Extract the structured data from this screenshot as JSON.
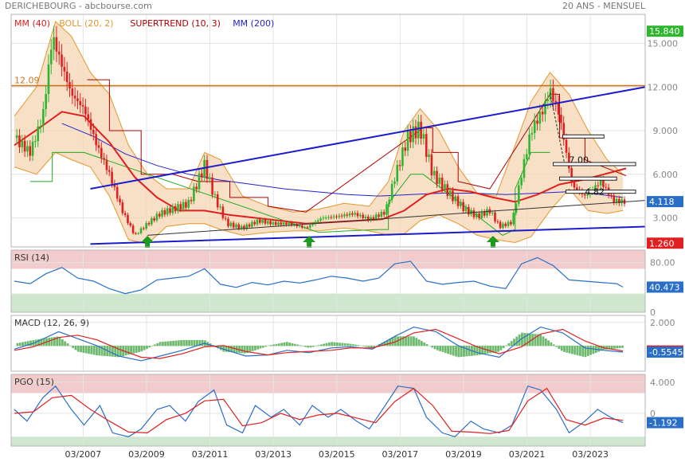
{
  "header": {
    "source": "DERICHEBOURG - abcbourse.com",
    "period": "20 ANS - MENSUEL"
  },
  "colors": {
    "up_candle": "#2fb52f",
    "down_candle": "#e02020",
    "mm40": "#e02020",
    "mm200": "#2222cc",
    "boll": "#e5962b",
    "supertrend": "#b00000",
    "supertrend_bull": "#22aa22",
    "trendline": "#1c1ccc",
    "resistance": "#c87420",
    "rsi_line": "#2a6ec8",
    "macd_line": "#2a6ec8",
    "signal_line": "#e02020",
    "hist": "#4aa84a",
    "zone_high": "#f2cccc",
    "zone_low": "#cfe6cf"
  },
  "chart_data": [
    {
      "type": "candlestick",
      "name": "price",
      "legend": [
        {
          "label": "MM (40)",
          "color": "#e02020"
        },
        {
          "label": "BOLL (20, 2)",
          "color": "#e5962b"
        },
        {
          "label": "SUPERTREND (10, 3)",
          "color": "#b00000"
        },
        {
          "label": "MM (200)",
          "color": "#2222cc"
        }
      ],
      "ylim": [
        1.0,
        17.0
      ],
      "y_ticks": [
        3.0,
        6.0,
        9.0,
        12.0,
        15.0
      ],
      "y_tick_labels": [
        "3.000",
        "6.000",
        "9.000",
        "12.000",
        "15.000"
      ],
      "x_range": [
        2004.9,
        2024.9
      ],
      "x_ticks": [
        2007,
        2009,
        2011,
        2013,
        2015,
        2017,
        2019,
        2021,
        2023
      ],
      "x_tick_labels": [
        "03/2007",
        "03/2009",
        "03/2011",
        "03/2013",
        "03/2015",
        "03/2017",
        "03/2019",
        "03/2021",
        "03/2023"
      ],
      "series_close": {
        "x": [
          2005.0,
          2005.5,
          2005.9,
          2006.2,
          2006.5,
          2006.8,
          2007.2,
          2007.6,
          2008.0,
          2008.4,
          2008.8,
          2009.2,
          2009.6,
          2010.0,
          2010.5,
          2011.0,
          2011.3,
          2011.7,
          2012.2,
          2012.7,
          2013.2,
          2013.7,
          2014.2,
          2014.7,
          2015.2,
          2015.7,
          2016.2,
          2016.7,
          2017.0,
          2017.4,
          2017.8,
          2018.2,
          2018.7,
          2019.2,
          2019.6,
          2020.0,
          2020.3,
          2020.7,
          2021.0,
          2021.3,
          2021.7,
          2021.9,
          2022.2,
          2022.6,
          2023.0,
          2023.5,
          2023.9,
          2024.2
        ],
        "y": [
          8.5,
          7.5,
          10.0,
          15.5,
          13.5,
          11.5,
          10.5,
          8.0,
          6.0,
          3.5,
          1.8,
          2.6,
          3.3,
          3.6,
          4.0,
          6.6,
          4.5,
          2.6,
          2.3,
          2.8,
          2.6,
          2.6,
          2.3,
          3.0,
          3.1,
          3.3,
          2.9,
          3.4,
          5.8,
          8.5,
          9.2,
          6.0,
          4.7,
          3.6,
          3.1,
          3.5,
          2.4,
          2.7,
          6.0,
          9.0,
          10.5,
          11.8,
          10.0,
          5.2,
          4.5,
          5.5,
          4.2,
          4.118
        ]
      },
      "mm40": {
        "x": [
          2005.0,
          2005.8,
          2006.5,
          2007.2,
          2008.0,
          2008.8,
          2009.5,
          2010.2,
          2011.0,
          2011.8,
          2012.6,
          2013.4,
          2014.2,
          2015.0,
          2015.8,
          2016.6,
          2017.3,
          2018.0,
          2018.7,
          2019.4,
          2020.1,
          2020.8,
          2021.5,
          2022.2,
          2022.9,
          2023.6,
          2024.3
        ],
        "y": [
          8.0,
          9.2,
          10.3,
          10.0,
          8.2,
          5.8,
          4.4,
          3.5,
          3.5,
          3.2,
          3.0,
          2.8,
          2.6,
          2.7,
          2.8,
          2.9,
          3.5,
          4.6,
          5.0,
          4.8,
          4.4,
          4.1,
          4.6,
          5.3,
          5.6,
          6.0,
          6.4
        ]
      },
      "mm200": {
        "x": [
          2006.5,
          2007.5,
          2008.5,
          2009.5,
          2010.5,
          2011.5,
          2012.5,
          2013.5,
          2014.5,
          2015.5,
          2016.5,
          2017.5,
          2018.5,
          2019.5,
          2020.5,
          2021.5,
          2022.5,
          2023.5,
          2024.2
        ],
        "y": [
          9.5,
          8.6,
          7.4,
          6.6,
          6.0,
          5.6,
          5.3,
          5.0,
          4.8,
          4.6,
          4.5,
          4.6,
          4.7,
          4.7,
          4.6,
          4.7,
          4.8,
          4.6,
          4.4
        ]
      },
      "boll_upper": {
        "x": [
          2005.0,
          2005.7,
          2006.3,
          2006.8,
          2007.4,
          2008.0,
          2008.6,
          2009.2,
          2009.8,
          2010.5,
          2011.0,
          2011.5,
          2012.2,
          2013.0,
          2013.8,
          2014.6,
          2015.4,
          2016.2,
          2016.8,
          2017.3,
          2017.8,
          2018.4,
          2019.0,
          2019.6,
          2020.2,
          2020.8,
          2021.3,
          2021.9,
          2022.5,
          2023.1,
          2023.7,
          2024.2
        ],
        "y": [
          10.0,
          12.0,
          16.5,
          15.5,
          13.0,
          11.5,
          8.0,
          6.0,
          5.0,
          5.0,
          7.5,
          7.0,
          4.5,
          3.8,
          3.4,
          3.6,
          4.0,
          3.8,
          5.5,
          9.0,
          10.5,
          9.0,
          6.5,
          4.7,
          4.5,
          8.0,
          11.0,
          13.0,
          11.5,
          9.0,
          7.0,
          6.0
        ]
      },
      "boll_lower": {
        "x": [
          2005.0,
          2005.7,
          2006.3,
          2006.8,
          2007.4,
          2008.0,
          2008.6,
          2009.2,
          2009.8,
          2010.5,
          2011.0,
          2011.5,
          2012.2,
          2013.0,
          2013.8,
          2014.6,
          2015.4,
          2016.2,
          2016.8,
          2017.3,
          2017.8,
          2018.4,
          2019.0,
          2019.6,
          2020.2,
          2020.8,
          2021.3,
          2021.9,
          2022.5,
          2023.1,
          2023.7,
          2024.2
        ],
        "y": [
          6.5,
          6.0,
          7.5,
          7.0,
          6.5,
          4.5,
          1.5,
          1.2,
          2.4,
          2.6,
          2.6,
          2.2,
          1.8,
          2.0,
          2.1,
          2.1,
          2.3,
          2.1,
          1.8,
          1.9,
          2.8,
          3.2,
          2.6,
          1.8,
          1.5,
          1.3,
          1.7,
          3.5,
          5.0,
          3.5,
          3.3,
          3.5
        ]
      },
      "supertrend_bear": {
        "x": [
          2007.3,
          2008.0,
          2008.0,
          2009.0,
          2009.0,
          2010.0,
          2010.8,
          2011.8,
          2011.8,
          2013.0,
          2013.0,
          2014.2,
          2017.9,
          2018.2,
          2018.2,
          2019.0,
          2019.0,
          2020.0,
          2021.9,
          2022.2,
          2022.2,
          2023.0,
          2023.0,
          2024.3
        ],
        "y": [
          12.5,
          12.5,
          9.0,
          9.0,
          6.0,
          6.0,
          5.5,
          5.5,
          4.4,
          4.4,
          3.8,
          3.4,
          9.2,
          9.2,
          7.5,
          7.5,
          5.5,
          5.0,
          11.5,
          11.5,
          8.5,
          8.5,
          7.0,
          5.9
        ]
      },
      "supertrend_bull": {
        "x": [
          2005.5,
          2006.2,
          2006.2,
          2007.2,
          2014.6,
          2015.5,
          2016.5,
          2016.8,
          2016.8,
          2017.5,
          2017.9,
          2020.4,
          2020.8,
          2020.8,
          2021.3,
          2021.9
        ],
        "y": [
          5.5,
          5.5,
          7.5,
          7.5,
          2.0,
          2.1,
          2.2,
          2.2,
          4.0,
          6.0,
          6.0,
          1.8,
          2.2,
          5.0,
          7.5,
          7.5
        ]
      },
      "resistance_level": 12.09,
      "resistance_label": "12.09",
      "trendline_upper": {
        "x": [
          2007.4,
          2024.9
        ],
        "y": [
          5.0,
          12.0
        ]
      },
      "trendline_lower": {
        "x": [
          2007.4,
          2024.9
        ],
        "y": [
          1.2,
          2.4
        ]
      },
      "trendline_mid": {
        "x": [
          2009.2,
          2024.9
        ],
        "y": [
          1.8,
          4.2
        ]
      },
      "annotations": [
        {
          "label": "7.00",
          "x": 2022.5,
          "y": 7.0
        },
        {
          "label": "4.82",
          "x": 2023.0,
          "y": 4.82
        }
      ],
      "arrows": [
        {
          "x": 2009.2
        },
        {
          "x": 2014.3
        },
        {
          "x": 2020.1
        }
      ],
      "right_labels": [
        {
          "label": "15.840",
          "value": 15.84,
          "color": "#2fb52f"
        },
        {
          "label": "4.118",
          "value": 4.118,
          "color": "#2a6ec8"
        },
        {
          "label": "1.260",
          "value": 1.26,
          "color": "#e02020"
        }
      ]
    },
    {
      "type": "line",
      "name": "rsi",
      "title": "RSI (14)",
      "ylim": [
        0,
        100
      ],
      "zones": {
        "high": 70,
        "low": 30
      },
      "y_ticks": [
        0,
        80
      ],
      "y_tick_labels": [
        "0",
        "80.00"
      ],
      "series": [
        {
          "name": "RSI",
          "x": [
            2005.0,
            2005.5,
            2006.0,
            2006.5,
            2007.0,
            2007.5,
            2008.0,
            2008.5,
            2009.0,
            2009.5,
            2010.0,
            2010.5,
            2011.0,
            2011.5,
            2012.0,
            2012.5,
            2013.0,
            2013.5,
            2014.0,
            2014.5,
            2015.0,
            2015.5,
            2016.0,
            2016.5,
            2017.0,
            2017.5,
            2018.0,
            2018.5,
            2019.0,
            2019.5,
            2020.0,
            2020.5,
            2021.0,
            2021.5,
            2022.0,
            2022.5,
            2023.0,
            2023.5,
            2024.0,
            2024.2
          ],
          "y": [
            50,
            46,
            62,
            72,
            55,
            50,
            38,
            30,
            36,
            52,
            55,
            58,
            70,
            45,
            40,
            48,
            44,
            50,
            47,
            52,
            58,
            55,
            50,
            55,
            78,
            82,
            50,
            45,
            48,
            50,
            42,
            38,
            78,
            88,
            75,
            52,
            50,
            48,
            46,
            40.473
          ]
        }
      ],
      "right_labels": [
        {
          "label": "40.473",
          "value": 40.473,
          "color": "#2a6ec8"
        }
      ]
    },
    {
      "type": "line",
      "name": "macd",
      "title": "MACD (12, 26, 9)",
      "ylim": [
        -2.2,
        2.6
      ],
      "y_ticks": [
        2.0
      ],
      "y_tick_labels": [
        "2.000"
      ],
      "series": [
        {
          "name": "MACD",
          "x": [
            2005.0,
            2005.6,
            2006.4,
            2007.0,
            2007.6,
            2008.3,
            2009.0,
            2009.6,
            2010.3,
            2011.0,
            2011.6,
            2012.3,
            2013.0,
            2013.6,
            2014.3,
            2015.0,
            2015.6,
            2016.3,
            2017.0,
            2017.6,
            2018.3,
            2019.0,
            2019.6,
            2020.3,
            2021.0,
            2021.6,
            2022.3,
            2023.0,
            2023.6,
            2024.2
          ],
          "y": [
            -0.3,
            0.2,
            1.2,
            0.6,
            0.0,
            -0.9,
            -1.3,
            -0.9,
            -0.4,
            0.2,
            -0.3,
            -0.9,
            -0.8,
            -0.4,
            -0.6,
            -0.2,
            -0.1,
            -0.3,
            0.8,
            1.6,
            1.2,
            0.0,
            -0.6,
            -1.0,
            0.6,
            1.6,
            1.1,
            -0.2,
            -0.4,
            -0.5545
          ]
        },
        {
          "name": "Signal",
          "x": [
            2005.0,
            2005.6,
            2006.4,
            2007.0,
            2007.6,
            2008.3,
            2009.0,
            2009.6,
            2010.3,
            2011.0,
            2011.6,
            2012.3,
            2013.0,
            2013.6,
            2014.3,
            2015.0,
            2015.6,
            2016.3,
            2017.0,
            2017.6,
            2018.3,
            2019.0,
            2019.6,
            2020.3,
            2021.0,
            2021.6,
            2022.3,
            2023.0,
            2023.6,
            2024.2
          ],
          "y": [
            -0.4,
            -0.1,
            0.7,
            0.9,
            0.5,
            -0.3,
            -1.0,
            -1.1,
            -0.7,
            -0.1,
            0.0,
            -0.5,
            -0.8,
            -0.6,
            -0.5,
            -0.4,
            -0.2,
            -0.2,
            0.3,
            1.1,
            1.4,
            0.6,
            -0.1,
            -0.7,
            -0.1,
            1.0,
            1.4,
            0.4,
            -0.2,
            -0.4597
          ]
        }
      ],
      "right_labels": [
        {
          "label": "-0.4597",
          "value": -0.4597,
          "color": "#e02020"
        },
        {
          "label": "-0.5545",
          "value": -0.5545,
          "color": "#2a6ec8"
        }
      ]
    },
    {
      "type": "line",
      "name": "pgo",
      "title": "PGO (15)",
      "ylim": [
        -4.2,
        5.0
      ],
      "zones": {
        "high": 2.6,
        "low": -3.0
      },
      "y_ticks": [
        0,
        4.0
      ],
      "y_tick_labels": [
        "0",
        "4.000"
      ],
      "series": [
        {
          "name": "PGO",
          "x": [
            2005.0,
            2005.4,
            2005.9,
            2006.3,
            2006.8,
            2007.2,
            2007.7,
            2008.1,
            2008.6,
            2009.0,
            2009.5,
            2009.9,
            2010.4,
            2010.8,
            2011.3,
            2011.7,
            2012.2,
            2012.6,
            2013.1,
            2013.5,
            2014.0,
            2014.4,
            2014.9,
            2015.3,
            2015.8,
            2016.2,
            2016.7,
            2017.1,
            2017.6,
            2018.0,
            2018.5,
            2018.9,
            2019.4,
            2019.8,
            2020.3,
            2020.7,
            2021.2,
            2021.6,
            2022.1,
            2022.5,
            2023.0,
            2023.4,
            2023.8,
            2024.2
          ],
          "y": [
            0.5,
            -1.0,
            2.0,
            3.5,
            0.5,
            -1.5,
            1.0,
            -2.5,
            -3.0,
            -2.0,
            0.5,
            1.0,
            -1.0,
            1.5,
            3.0,
            -1.5,
            -2.5,
            1.0,
            -0.5,
            0.5,
            -1.5,
            1.0,
            -0.5,
            0.5,
            -1.0,
            -2.0,
            1.0,
            3.5,
            3.2,
            -0.5,
            -2.5,
            -3.0,
            -1.0,
            -2.0,
            -2.5,
            -1.5,
            3.5,
            3.0,
            0.5,
            -2.5,
            -1.0,
            0.5,
            -0.5,
            -1.192
          ]
        },
        {
          "name": "Signal",
          "x": [
            2005.0,
            2005.6,
            2006.2,
            2006.8,
            2007.4,
            2008.0,
            2008.6,
            2009.2,
            2009.8,
            2010.4,
            2011.0,
            2011.6,
            2012.2,
            2012.8,
            2013.4,
            2014.0,
            2014.6,
            2015.2,
            2015.8,
            2016.4,
            2017.0,
            2017.6,
            2018.2,
            2018.8,
            2019.4,
            2020.0,
            2020.6,
            2021.2,
            2021.8,
            2022.4,
            2023.0,
            2023.6,
            2024.2
          ],
          "y": [
            0.0,
            0.2,
            2.0,
            2.3,
            0.5,
            -1.0,
            -2.4,
            -2.5,
            -0.8,
            0.0,
            1.6,
            1.8,
            -1.6,
            -1.2,
            0.0,
            -0.8,
            -0.2,
            0.0,
            -0.6,
            -1.2,
            1.5,
            3.2,
            1.0,
            -2.3,
            -2.4,
            -2.6,
            -2.2,
            1.6,
            3.2,
            -0.8,
            -1.5,
            -0.6,
            -0.9
          ]
        }
      ],
      "right_labels": [
        {
          "label": "-1.192",
          "value": -1.192,
          "color": "#2a6ec8"
        }
      ]
    }
  ]
}
